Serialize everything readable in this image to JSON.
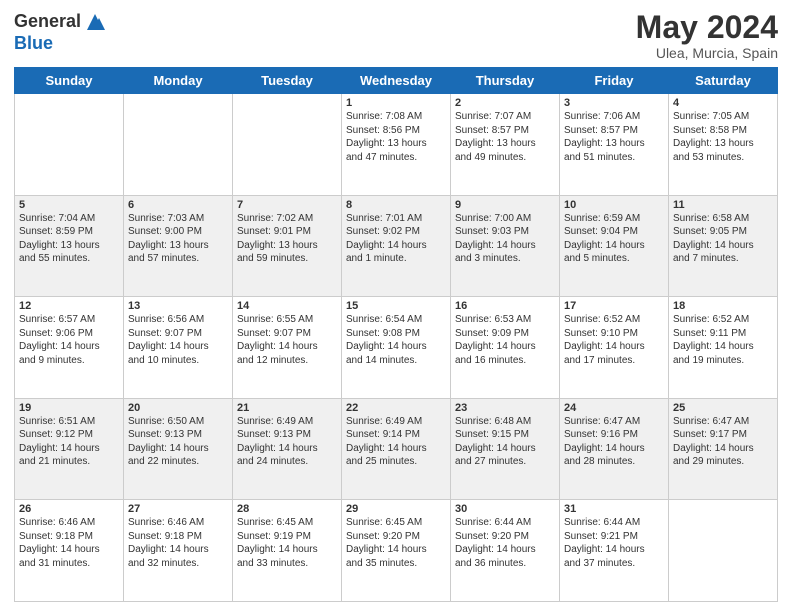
{
  "header": {
    "logo_line1": "General",
    "logo_line2": "Blue",
    "month_title": "May 2024",
    "location": "Ulea, Murcia, Spain"
  },
  "days_of_week": [
    "Sunday",
    "Monday",
    "Tuesday",
    "Wednesday",
    "Thursday",
    "Friday",
    "Saturday"
  ],
  "weeks": [
    [
      {
        "day": "",
        "info": ""
      },
      {
        "day": "",
        "info": ""
      },
      {
        "day": "",
        "info": ""
      },
      {
        "day": "1",
        "info": "Sunrise: 7:08 AM\nSunset: 8:56 PM\nDaylight: 13 hours\nand 47 minutes."
      },
      {
        "day": "2",
        "info": "Sunrise: 7:07 AM\nSunset: 8:57 PM\nDaylight: 13 hours\nand 49 minutes."
      },
      {
        "day": "3",
        "info": "Sunrise: 7:06 AM\nSunset: 8:57 PM\nDaylight: 13 hours\nand 51 minutes."
      },
      {
        "day": "4",
        "info": "Sunrise: 7:05 AM\nSunset: 8:58 PM\nDaylight: 13 hours\nand 53 minutes."
      }
    ],
    [
      {
        "day": "5",
        "info": "Sunrise: 7:04 AM\nSunset: 8:59 PM\nDaylight: 13 hours\nand 55 minutes."
      },
      {
        "day": "6",
        "info": "Sunrise: 7:03 AM\nSunset: 9:00 PM\nDaylight: 13 hours\nand 57 minutes."
      },
      {
        "day": "7",
        "info": "Sunrise: 7:02 AM\nSunset: 9:01 PM\nDaylight: 13 hours\nand 59 minutes."
      },
      {
        "day": "8",
        "info": "Sunrise: 7:01 AM\nSunset: 9:02 PM\nDaylight: 14 hours\nand 1 minute."
      },
      {
        "day": "9",
        "info": "Sunrise: 7:00 AM\nSunset: 9:03 PM\nDaylight: 14 hours\nand 3 minutes."
      },
      {
        "day": "10",
        "info": "Sunrise: 6:59 AM\nSunset: 9:04 PM\nDaylight: 14 hours\nand 5 minutes."
      },
      {
        "day": "11",
        "info": "Sunrise: 6:58 AM\nSunset: 9:05 PM\nDaylight: 14 hours\nand 7 minutes."
      }
    ],
    [
      {
        "day": "12",
        "info": "Sunrise: 6:57 AM\nSunset: 9:06 PM\nDaylight: 14 hours\nand 9 minutes."
      },
      {
        "day": "13",
        "info": "Sunrise: 6:56 AM\nSunset: 9:07 PM\nDaylight: 14 hours\nand 10 minutes."
      },
      {
        "day": "14",
        "info": "Sunrise: 6:55 AM\nSunset: 9:07 PM\nDaylight: 14 hours\nand 12 minutes."
      },
      {
        "day": "15",
        "info": "Sunrise: 6:54 AM\nSunset: 9:08 PM\nDaylight: 14 hours\nand 14 minutes."
      },
      {
        "day": "16",
        "info": "Sunrise: 6:53 AM\nSunset: 9:09 PM\nDaylight: 14 hours\nand 16 minutes."
      },
      {
        "day": "17",
        "info": "Sunrise: 6:52 AM\nSunset: 9:10 PM\nDaylight: 14 hours\nand 17 minutes."
      },
      {
        "day": "18",
        "info": "Sunrise: 6:52 AM\nSunset: 9:11 PM\nDaylight: 14 hours\nand 19 minutes."
      }
    ],
    [
      {
        "day": "19",
        "info": "Sunrise: 6:51 AM\nSunset: 9:12 PM\nDaylight: 14 hours\nand 21 minutes."
      },
      {
        "day": "20",
        "info": "Sunrise: 6:50 AM\nSunset: 9:13 PM\nDaylight: 14 hours\nand 22 minutes."
      },
      {
        "day": "21",
        "info": "Sunrise: 6:49 AM\nSunset: 9:13 PM\nDaylight: 14 hours\nand 24 minutes."
      },
      {
        "day": "22",
        "info": "Sunrise: 6:49 AM\nSunset: 9:14 PM\nDaylight: 14 hours\nand 25 minutes."
      },
      {
        "day": "23",
        "info": "Sunrise: 6:48 AM\nSunset: 9:15 PM\nDaylight: 14 hours\nand 27 minutes."
      },
      {
        "day": "24",
        "info": "Sunrise: 6:47 AM\nSunset: 9:16 PM\nDaylight: 14 hours\nand 28 minutes."
      },
      {
        "day": "25",
        "info": "Sunrise: 6:47 AM\nSunset: 9:17 PM\nDaylight: 14 hours\nand 29 minutes."
      }
    ],
    [
      {
        "day": "26",
        "info": "Sunrise: 6:46 AM\nSunset: 9:18 PM\nDaylight: 14 hours\nand 31 minutes."
      },
      {
        "day": "27",
        "info": "Sunrise: 6:46 AM\nSunset: 9:18 PM\nDaylight: 14 hours\nand 32 minutes."
      },
      {
        "day": "28",
        "info": "Sunrise: 6:45 AM\nSunset: 9:19 PM\nDaylight: 14 hours\nand 33 minutes."
      },
      {
        "day": "29",
        "info": "Sunrise: 6:45 AM\nSunset: 9:20 PM\nDaylight: 14 hours\nand 35 minutes."
      },
      {
        "day": "30",
        "info": "Sunrise: 6:44 AM\nSunset: 9:20 PM\nDaylight: 14 hours\nand 36 minutes."
      },
      {
        "day": "31",
        "info": "Sunrise: 6:44 AM\nSunset: 9:21 PM\nDaylight: 14 hours\nand 37 minutes."
      },
      {
        "day": "",
        "info": ""
      }
    ]
  ]
}
